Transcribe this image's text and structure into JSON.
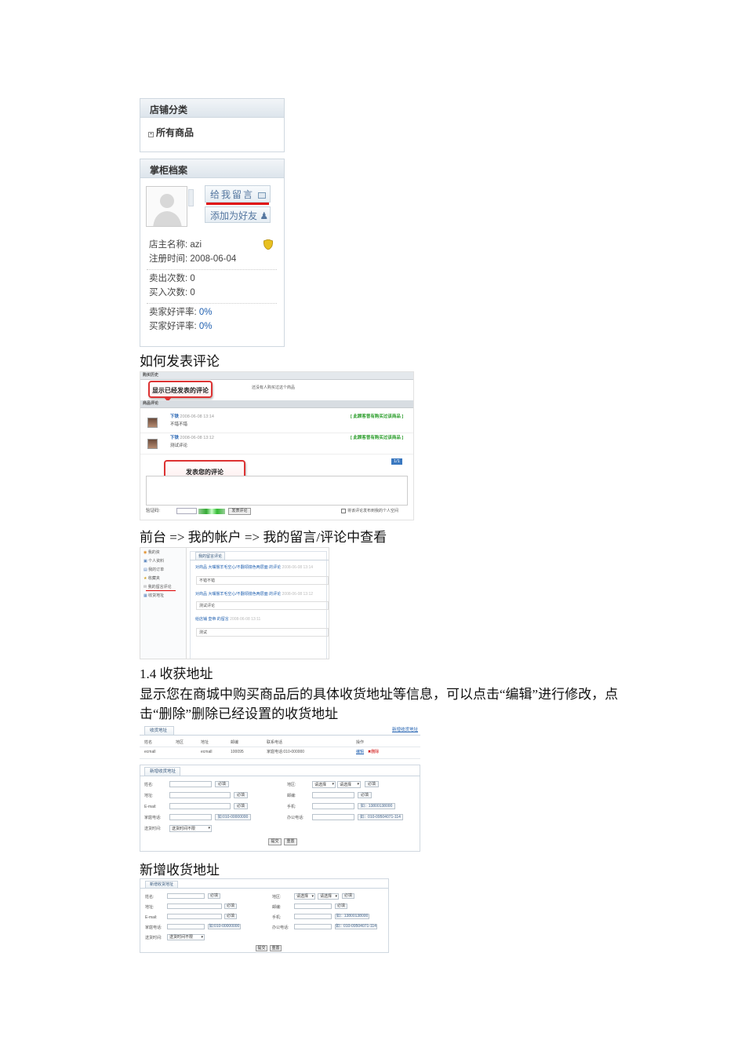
{
  "shop_panel": {
    "category_title": "店铺分类",
    "all_goods": "所有商品",
    "profile_title": "掌柜档案",
    "leave_msg_btn": "给我留言",
    "add_friend_btn": "添加为好友",
    "owner_label": "店主名称:",
    "owner_value": "azi",
    "reg_label": "注册时间:",
    "reg_value": "2008-06-04",
    "sold_label": "卖出次数:",
    "sold_value": "0",
    "bought_label": "买入次数:",
    "bought_value": "0",
    "seller_rate_label": "卖家好评率:",
    "seller_rate_value": "0%",
    "buyer_rate_label": "买家好评率:",
    "buyer_rate_value": "0%"
  },
  "doc": {
    "h_comment": "如何发表评论",
    "path_text": "前台 => 我的帐户 => 我的留言/评论中查看",
    "section_14": "1.4 收获地址",
    "para_line1": "显示您在商城中购买商品后的具体收货地址等信息，可以点击“编辑”进行修改，点",
    "para_line2": "击“删除”删除已经设置的收货地址",
    "h_new_addr": "新增收货地址"
  },
  "comment_shot": {
    "history_title": "购买历史",
    "history_empty": "还没有人购买过这个商品",
    "callout_published": "显示已经发表的评论",
    "comments_title": "商品评论",
    "comments": [
      {
        "user": "下铁",
        "time": "2008-06-08 13:14",
        "text": "不错不错",
        "badge": "[ 此顾客曾有购买过该商品 ]"
      },
      {
        "user": "下铁",
        "time": "2008-06-08 13:12",
        "text": "测试评论",
        "badge": "[ 此顾客曾有购买过该商品 ]"
      }
    ],
    "pager": "1/1",
    "callout_post": "发表您的评论",
    "captcha_label": "验证码:",
    "submit_btn": "发表评论",
    "checkbox_label": "将该评论发布到我的个人空间"
  },
  "account_shot": {
    "menu": [
      "我的资",
      "个人资料",
      "我的订单",
      "收藏夹",
      "我的留言评论",
      "收货地址"
    ],
    "tab": "我的留言评论",
    "entries": [
      {
        "title": "对商品 大嘴猴羊毛空心/不翻领撞色两层面 的评论",
        "time": "2008-06-08 13:14",
        "body": "不错不错"
      },
      {
        "title": "对商品 大嘴猴羊毛空心/不翻领撞色两层面 的评论",
        "time": "2008-06-08 13:12",
        "body": "测试评论"
      },
      {
        "title": "给店铺 皇帝 的留言",
        "time": "2008-06-08 13:11",
        "body": "测试"
      }
    ]
  },
  "address_list": {
    "tab": "收货地址",
    "add_link": "新增收货地址",
    "headers": [
      "姓名",
      "地区",
      "地址",
      "邮编",
      "联系电话",
      "操作"
    ],
    "row": [
      "ecmall",
      "",
      "ecmall",
      "100095",
      "家庭电话:010-000000"
    ],
    "edit": "编辑",
    "delete": "删除"
  },
  "address_form": {
    "tab": "新增收货地址",
    "name_label": "姓名:",
    "addr_label": "地址:",
    "email_label": "E-mail:",
    "home_label": "家庭电话:",
    "time_label": "送货时间:",
    "region_label": "地区:",
    "zip_label": "邮编:",
    "mobile_label": "手机:",
    "office_label": "办公电话:",
    "required": "必填",
    "select_placeholder": "请选择",
    "home_hint": "如:010-00000000",
    "mobile_hint": "如：13800138000",
    "office_hint": "如：010-09504071-114",
    "time_value": "送货时间不限",
    "submit": "提交",
    "reset": "重置"
  }
}
